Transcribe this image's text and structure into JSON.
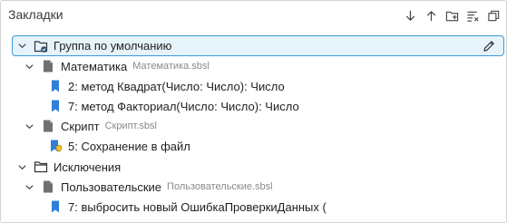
{
  "panel": {
    "title": "Закладки",
    "toolbar": [
      {
        "name": "arrow-down-icon"
      },
      {
        "name": "arrow-up-icon"
      },
      {
        "name": "add-folder-icon"
      },
      {
        "name": "clear-list-icon"
      },
      {
        "name": "restore-window-icon"
      }
    ]
  },
  "tree": {
    "group_default": {
      "label": "Группа по умолчанию",
      "edit_icon": "pencil-icon"
    },
    "module_math": {
      "label": "Математика",
      "file": "Математика.sbsl"
    },
    "bm_square": {
      "label": "2: метод Квадрат(Число: Число): Число"
    },
    "bm_factorial": {
      "label": "7: метод Факториал(Число: Число): Число"
    },
    "module_script": {
      "label": "Скрипт",
      "file": "Скрипт.sbsl"
    },
    "bm_save": {
      "label": "5: Сохранение в файл"
    },
    "group_exceptions": {
      "label": "Исключения"
    },
    "module_user": {
      "label": "Пользовательские",
      "file": "Пользовательские.sbsl"
    },
    "bm_throw": {
      "label": "7: выбросить новый ОшибкаПроверкиДанных ("
    }
  },
  "colors": {
    "bookmark": "#2f7fd8",
    "bookmark_conditional": "#2f7fd8",
    "condition_badge": "#f2c230",
    "selection_bg": "#e6f3fb",
    "selection_border": "#3b99d6"
  }
}
